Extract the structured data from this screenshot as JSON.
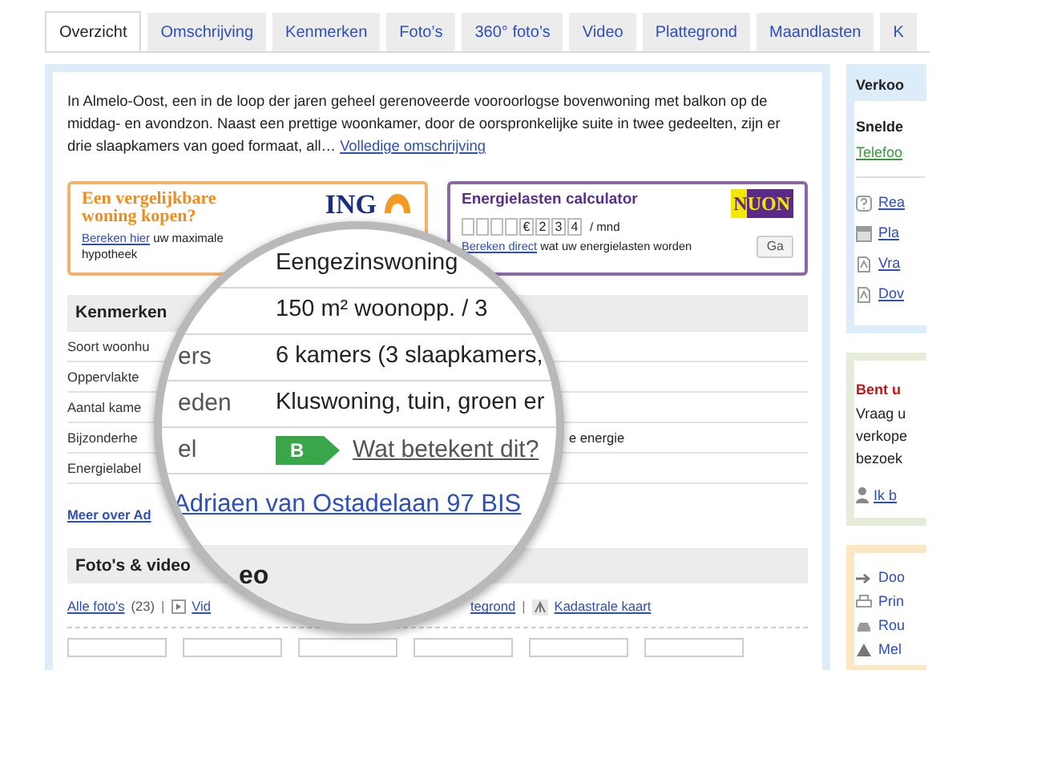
{
  "tabs": [
    {
      "label": "Overzicht",
      "selected": true
    },
    {
      "label": "Omschrijving",
      "selected": false
    },
    {
      "label": "Kenmerken",
      "selected": false
    },
    {
      "label": "Foto’s",
      "selected": false
    },
    {
      "label": "360° foto’s",
      "selected": false
    },
    {
      "label": "Video",
      "selected": false
    },
    {
      "label": "Plattegrond",
      "selected": false
    },
    {
      "label": "Maandlasten",
      "selected": false
    },
    {
      "label": "K",
      "selected": false
    }
  ],
  "description": {
    "text": "In Almelo-Oost, een in de loop der jaren geheel gerenoveerde vooroorlogse bovenwoning met balkon op de middag- en avondzon. Naast een prettige woonkamer, door de oorspronkelijke suite in twee gedeelten, zijn er drie slaapkamers van goed formaat, all…",
    "link": "Volledige omschrijving"
  },
  "mortgage_ad": {
    "title": "Een vergelijkbare woning kopen?",
    "logo": "ING",
    "link": "Bereken hier",
    "text": "uw maximale hypotheek"
  },
  "energy_ad": {
    "title": "Energielasten calculator",
    "logo": [
      "N",
      "UON"
    ],
    "meter_digits": [
      "€",
      "2",
      "3",
      "4"
    ],
    "unit": "/ mnd",
    "link": "Bereken direct",
    "text": "wat uw energielasten worden",
    "button": "Ga"
  },
  "features": {
    "title": "Kenmerken",
    "rows": [
      {
        "label": "Soort woonhu"
      },
      {
        "label": "Oppervlakte"
      },
      {
        "label": "Aantal kame"
      },
      {
        "label": "Bijzonderhe",
        "note": "e energie"
      },
      {
        "label": "Energielabel"
      }
    ],
    "more_link": "Meer over Ad"
  },
  "media": {
    "title": "Foto's & video",
    "all_link": "Alle foto's",
    "count": "(23)",
    "separator": "|",
    "video_link": "Vid",
    "floorplan_link": "tegrond",
    "separator_2": "|",
    "map_link": "Kadastrale kaart"
  },
  "magnifier": {
    "rows": [
      {
        "kind": "text",
        "value": "Eengezinswoning"
      },
      {
        "kind": "text",
        "value": "150 m² woonopp. / 3"
      },
      {
        "kind": "text",
        "label": "ers",
        "value": "6 kamers (3 slaapkamers,"
      },
      {
        "kind": "text",
        "label": "eden",
        "value": "Kluswoning, tuin, groen er"
      },
      {
        "kind": "energy",
        "label": "el",
        "badge": "B",
        "link": "Wat betekent dit?"
      }
    ],
    "address": "Adriaen van Ostadelaan 97 BIS",
    "heading": "eo"
  },
  "sidebar": {
    "seller": {
      "title": "Verkoo",
      "subtitle": "Snelde",
      "phone_link": "Telefoo",
      "links": [
        {
          "kind": "help",
          "label": "Rea"
        },
        {
          "kind": "calendar",
          "label": "Pla"
        },
        {
          "kind": "document",
          "label": "Vra"
        },
        {
          "kind": "document",
          "label": "Dov"
        }
      ]
    },
    "visit": {
      "title": "Bent u",
      "lines": [
        "Vraag u",
        "verkope",
        "bezoek"
      ],
      "link": "Ik b"
    },
    "actions": [
      {
        "kind": "arrow",
        "label": "Doo"
      },
      {
        "kind": "printer",
        "label": "Prin"
      },
      {
        "kind": "car",
        "label": "Rou"
      },
      {
        "kind": "warning",
        "label": "Mel"
      }
    ]
  }
}
